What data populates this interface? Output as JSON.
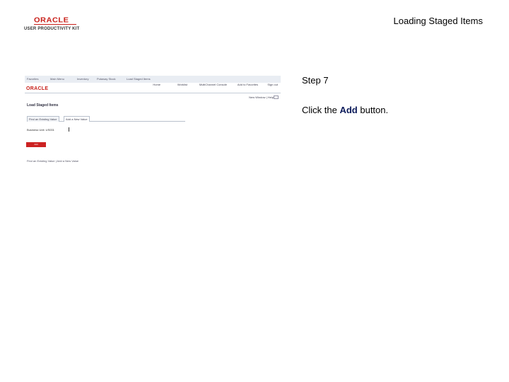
{
  "logo": {
    "wordmark": "ORACLE",
    "subtitle": "USER PRODUCTIVITY KIT"
  },
  "page_title": "Loading Staged Items",
  "screenshot": {
    "nav": [
      "Favorites",
      "Main Menu",
      "Inventory",
      "Putaway Stock",
      "Load Staged Items"
    ],
    "logo": "ORACLE",
    "top_links": [
      "Home",
      "Worklist",
      "MultiChannel Console",
      "Add to Favorites",
      "Sign out"
    ],
    "util_links": "New Window | Help",
    "page_title": "Load Staged Items",
    "tabs": [
      "Find an Existing Value",
      "Add a New Value"
    ],
    "field_text": "Business Unit: US001",
    "button_label": "Add",
    "footer_text": "Find an Existing Value | Add a New Value"
  },
  "step": {
    "label": "Step 7",
    "instruction_prefix": "Click the ",
    "instruction_target": "Add",
    "instruction_suffix": " button."
  }
}
